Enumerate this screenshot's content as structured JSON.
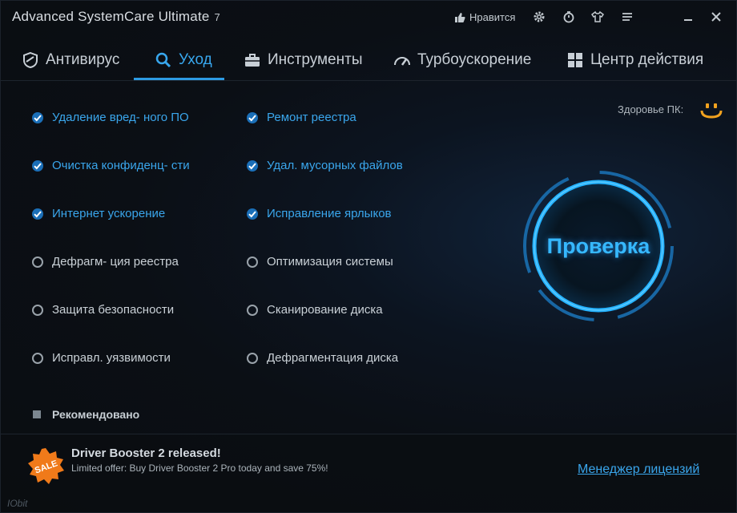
{
  "app": {
    "title": "Advanced SystemCare Ultimate",
    "version": "7"
  },
  "titlebar": {
    "like_label": "Нравится"
  },
  "tabs": [
    {
      "label": "Антивирус",
      "icon": "shield-icon"
    },
    {
      "label": "Уход",
      "icon": "search-icon",
      "active": true
    },
    {
      "label": "Инструменты",
      "icon": "toolbox-icon"
    },
    {
      "label": "Турбоускорение",
      "icon": "speedometer-icon"
    },
    {
      "label": "Центр действия",
      "icon": "grid-icon"
    }
  ],
  "options": {
    "left": [
      {
        "label": "Удаление вред- ного ПО",
        "checked": true
      },
      {
        "label": "Очистка конфиденц- сти",
        "checked": true
      },
      {
        "label": "Интернет ускорение",
        "checked": true
      },
      {
        "label": "Дефрагм- ция реестра",
        "checked": false
      },
      {
        "label": "Защита безопасности",
        "checked": false
      },
      {
        "label": "Исправл. уязвимости",
        "checked": false
      }
    ],
    "right": [
      {
        "label": "Ремонт реестра",
        "checked": true
      },
      {
        "label": "Удал. мусорных файлов",
        "checked": true
      },
      {
        "label": "Исправление ярлыков",
        "checked": true
      },
      {
        "label": "Оптимизация системы",
        "checked": false
      },
      {
        "label": "Сканирование диска",
        "checked": false
      },
      {
        "label": "Дефрагментация диска",
        "checked": false
      }
    ]
  },
  "recommended_label": "Рекомендовано",
  "health": {
    "label": "Здоровье ПК:"
  },
  "scan": {
    "label": "Проверка"
  },
  "footer": {
    "sale_label": "SALE",
    "promo_title": "Driver Booster 2 released!",
    "promo_subtitle": "Limited offer: Buy Driver Booster 2 Pro today and save 75%!",
    "license_link": "Менеджер лицензий",
    "brand": "IObit"
  },
  "colors": {
    "accent": "#3aa6ec",
    "background": "#0b0e12",
    "sale": "#f07a1a"
  }
}
